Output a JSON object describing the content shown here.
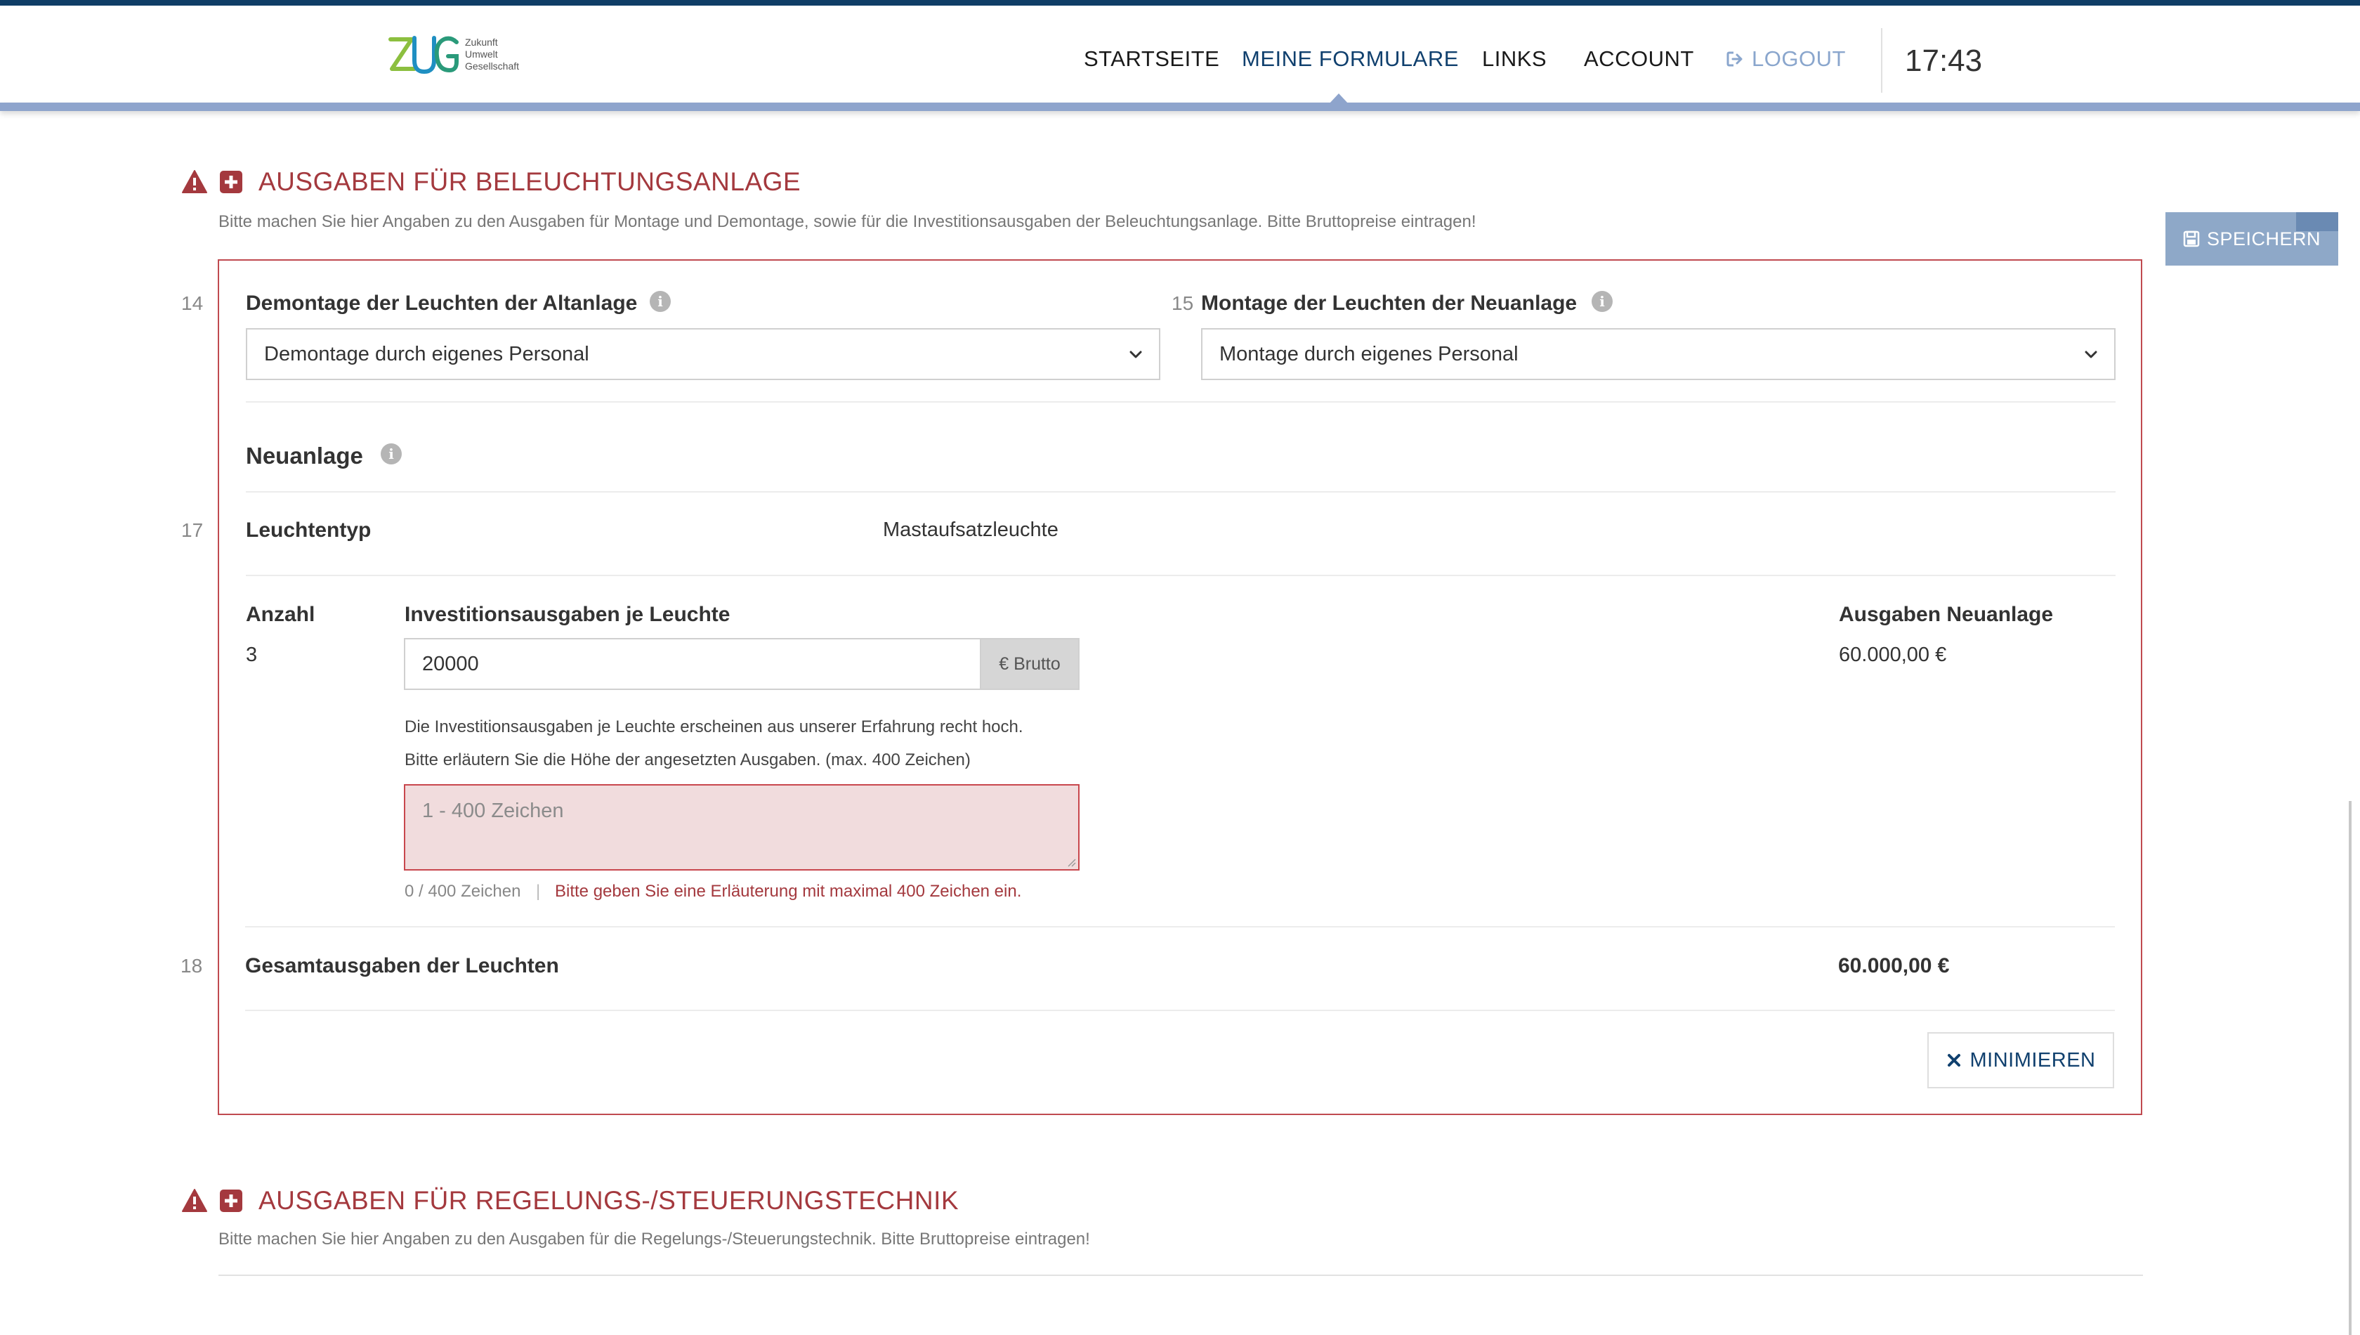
{
  "header": {
    "logo": {
      "line1": "Zukunft",
      "line2": "Umwelt",
      "line3": "Gesellschaft"
    },
    "nav": [
      {
        "label": "STARTSEITE"
      },
      {
        "label": "MEINE FORMULARE"
      },
      {
        "label": "LINKS"
      },
      {
        "label": "ACCOUNT"
      },
      {
        "label": "LOGOUT"
      }
    ],
    "clock": "17:43"
  },
  "toolbar": {
    "save_label": "SPEICHERN"
  },
  "section1": {
    "title": "AUSGABEN FÜR BELEUCHTUNGSANLAGE",
    "description": "Bitte machen Sie hier Angaben zu den Ausgaben für Montage und Demontage, sowie für die Investitionsausgaben der Beleuchtungsanlage. Bitte Bruttopreise eintragen!",
    "q14": {
      "num": "14",
      "label": "Demontage der Leuchten der Altanlage",
      "value": "Demontage durch eigenes Personal"
    },
    "q15": {
      "num": "15",
      "label": "Montage der Leuchten der Neuanlage",
      "value": "Montage durch eigenes Personal"
    },
    "neuanlage_title": "Neuanlage",
    "q17": {
      "num": "17",
      "label": "Leuchtentyp",
      "value": "Mastaufsatzleuchte"
    },
    "table": {
      "col_count": "Anzahl",
      "col_invest": "Investitionsausgaben je Leuchte",
      "col_total": "Ausgaben Neuanlage",
      "count": "3",
      "invest_value": "20000",
      "invest_unit": "€ Brutto",
      "total": "60.000,00 €"
    },
    "hint_line1": "Die Investitionsausgaben je Leuchte erscheinen aus unserer Erfahrung recht hoch.",
    "hint_line2": "Bitte erläutern Sie die Höhe der angesetzten Ausgaben. (max. 400 Zeichen)",
    "textarea_placeholder": "1 - 400 Zeichen",
    "char_counter": "0 / 400 Zeichen",
    "separator": "|",
    "error": "Bitte geben Sie eine Erläuterung mit maximal 400 Zeichen ein.",
    "q18": {
      "num": "18",
      "label": "Gesamtausgaben der Leuchten",
      "value": "60.000,00 €"
    },
    "minimize_label": "MINIMIEREN"
  },
  "section2": {
    "title": "AUSGABEN FÜR REGELUNGS-/STEUERUNGSTECHNIK",
    "description": "Bitte machen Sie hier Angaben zu den Ausgaben für die Regelungs-/Steuerungstechnik. Bitte Bruttopreise eintragen!"
  },
  "colors": {
    "brand": "#10406e",
    "error": "#a4393e",
    "header_bar": "#0f3d66",
    "save": "#8ea8c8"
  }
}
